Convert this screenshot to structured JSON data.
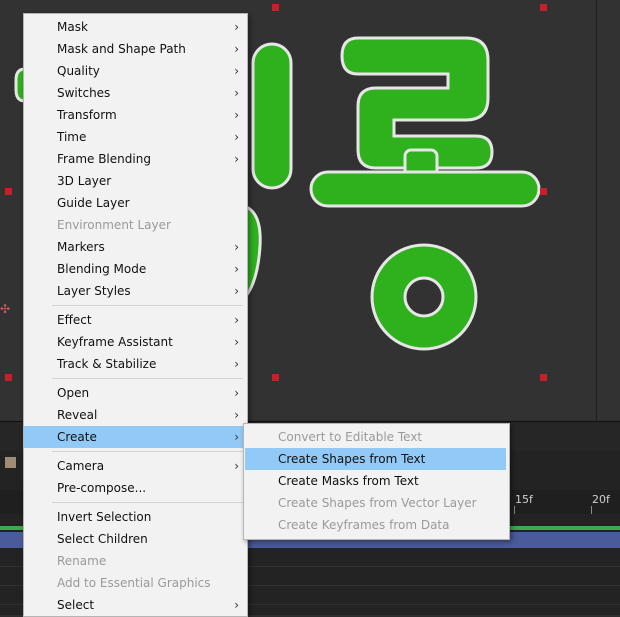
{
  "main_menu": {
    "groups": [
      [
        {
          "label": "Mask",
          "submenu": true,
          "enabled": true
        },
        {
          "label": "Mask and Shape Path",
          "submenu": true,
          "enabled": true
        },
        {
          "label": "Quality",
          "submenu": true,
          "enabled": true
        },
        {
          "label": "Switches",
          "submenu": true,
          "enabled": true
        },
        {
          "label": "Transform",
          "submenu": true,
          "enabled": true
        },
        {
          "label": "Time",
          "submenu": true,
          "enabled": true
        },
        {
          "label": "Frame Blending",
          "submenu": true,
          "enabled": true
        },
        {
          "label": "3D Layer",
          "submenu": false,
          "enabled": true
        },
        {
          "label": "Guide Layer",
          "submenu": false,
          "enabled": true
        },
        {
          "label": "Environment Layer",
          "submenu": false,
          "enabled": false
        },
        {
          "label": "Markers",
          "submenu": true,
          "enabled": true
        },
        {
          "label": "Blending Mode",
          "submenu": true,
          "enabled": true
        },
        {
          "label": "Layer Styles",
          "submenu": true,
          "enabled": true
        }
      ],
      [
        {
          "label": "Effect",
          "submenu": true,
          "enabled": true
        },
        {
          "label": "Keyframe Assistant",
          "submenu": true,
          "enabled": true
        },
        {
          "label": "Track & Stabilize",
          "submenu": true,
          "enabled": true
        }
      ],
      [
        {
          "label": "Open",
          "submenu": true,
          "enabled": true
        },
        {
          "label": "Reveal",
          "submenu": true,
          "enabled": true
        },
        {
          "label": "Create",
          "submenu": true,
          "enabled": true,
          "highlighted": true
        }
      ],
      [
        {
          "label": "Camera",
          "submenu": true,
          "enabled": true
        },
        {
          "label": "Pre-compose...",
          "submenu": false,
          "enabled": true
        }
      ],
      [
        {
          "label": "Invert Selection",
          "submenu": false,
          "enabled": true
        },
        {
          "label": "Select Children",
          "submenu": false,
          "enabled": true
        },
        {
          "label": "Rename",
          "submenu": false,
          "enabled": false
        },
        {
          "label": "Add to Essential Graphics",
          "submenu": false,
          "enabled": false
        },
        {
          "label": "Select",
          "submenu": true,
          "enabled": true
        }
      ]
    ]
  },
  "create_submenu": {
    "items": [
      {
        "label": "Convert to Editable Text",
        "enabled": false
      },
      {
        "label": "Create Shapes from Text",
        "enabled": true,
        "highlighted": true
      },
      {
        "label": "Create Masks from Text",
        "enabled": true
      },
      {
        "label": "Create Shapes from Vector Layer",
        "enabled": false
      },
      {
        "label": "Create Keyframes from Data",
        "enabled": false
      }
    ]
  },
  "timeline": {
    "ruler_ticks": [
      "15f",
      "20f"
    ]
  },
  "colors": {
    "text_fill": "#2fb11d",
    "text_stroke": "#e6e6e6",
    "highlight": "#91c9f7",
    "handle": "#c8202a",
    "work_area": "#3ca94a",
    "layer_bar": "#4a5b9a"
  },
  "icons": {
    "submenu_arrow": "chevron-right-icon",
    "anchor": "anchor-point-icon"
  }
}
